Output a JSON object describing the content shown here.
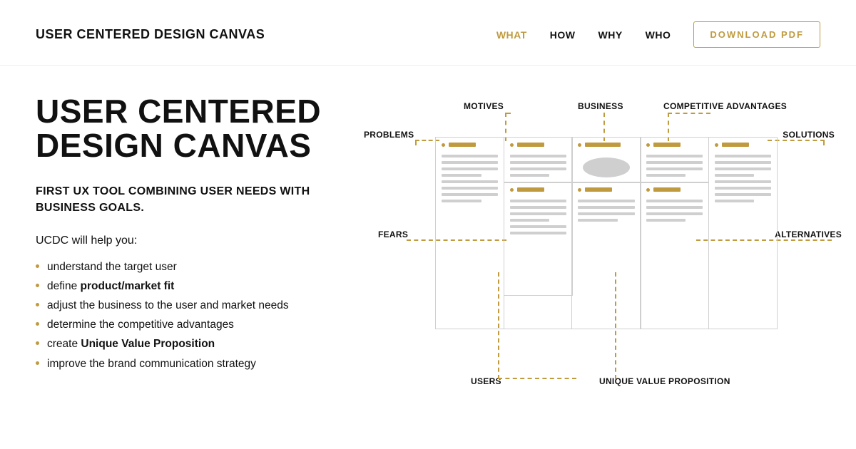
{
  "header": {
    "brand": "USER CENTERED DESIGN CANVAS",
    "nav": {
      "what": "WHAT",
      "how": "HOW",
      "why": "WHY",
      "who": "WHO"
    },
    "download": "DOWNLOAD  PDF"
  },
  "hero": {
    "title_line1": "USER CENTERED",
    "title_line2": "DESIGN CANVAS",
    "subtitle": "FIRST UX TOOL COMBINING USER NEEDS WITH BUSINESS GOALS.",
    "lead": "UCDC will help you:",
    "bullets": [
      {
        "pre": "understand the target user",
        "strong": "",
        "post": ""
      },
      {
        "pre": "define ",
        "strong": "product/market fit",
        "post": ""
      },
      {
        "pre": "adjust the business to the user and market needs",
        "strong": "",
        "post": ""
      },
      {
        "pre": "determine the competitive advantages",
        "strong": "",
        "post": ""
      },
      {
        "pre": "create ",
        "strong": "Unique Value Proposition",
        "post": ""
      },
      {
        "pre": "improve the brand communication strategy",
        "strong": "",
        "post": ""
      }
    ]
  },
  "diagram": {
    "labels": {
      "problems": "PROBLEMS",
      "motives": "MOTIVES",
      "business": "BUSINESS",
      "compadv": "COMPETITIVE ADVANTAGES",
      "solutions": "SOLUTIONS",
      "fears": "FEARS",
      "alternatives": "ALTERNATIVES",
      "users": "USERS",
      "uvp": "UNIQUE VALUE PROPOSITION"
    }
  },
  "colors": {
    "accent": "#c09a3e"
  }
}
